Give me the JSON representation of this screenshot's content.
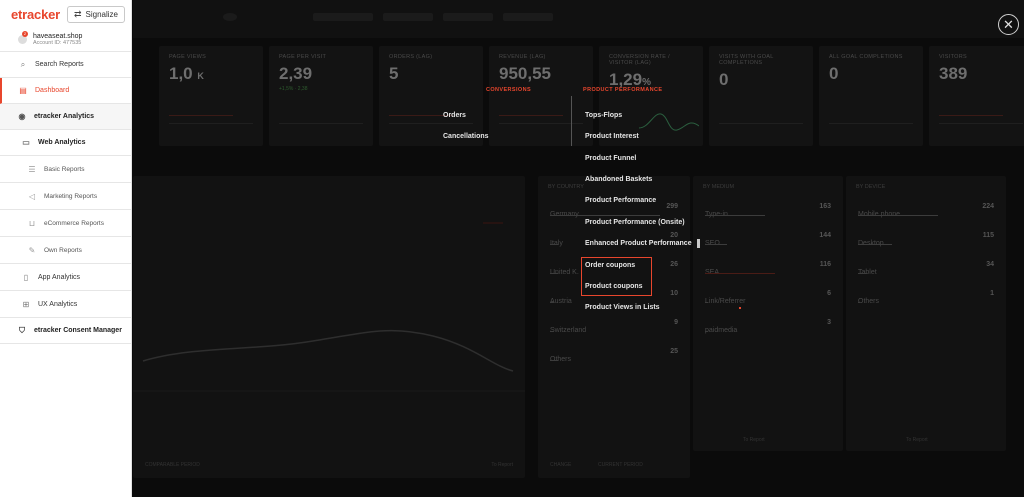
{
  "brand": {
    "logo": "etracker",
    "signalize_label": "Signalize"
  },
  "account": {
    "name": "haveaseat.shop",
    "id": "Account ID: 477535",
    "badge": "2"
  },
  "nav": {
    "search": "Search Reports",
    "dashboard": "Dashboard",
    "etracker_analytics": "etracker Analytics",
    "web_analytics": "Web Analytics",
    "basic_reports": "Basic Reports",
    "marketing_reports": "Marketing Reports",
    "ecommerce_reports": "eCommerce Reports",
    "own_reports": "Own Reports",
    "app_analytics": "App Analytics",
    "ux_analytics": "UX Analytics",
    "consent_manager": "etracker Consent Manager"
  },
  "menu": {
    "conversions_heading": "CONVERSIONS",
    "product_heading": "PRODUCT PERFORMANCE",
    "conversions": [
      "Orders",
      "Cancellations"
    ],
    "product": [
      "Tops-Flops",
      "Product Interest",
      "Product Funnel",
      "Abandoned Baskets",
      "Product Performance",
      "Product Performance (Onsite)",
      "Enhanced Product Performance",
      "Order coupons",
      "Product coupons",
      "Product Views in Lists"
    ]
  },
  "kpis": [
    {
      "label": "PAGE VIEWS",
      "value": "1,0",
      "unit": "K"
    },
    {
      "label": "PAGE PER VISIT",
      "value": "2,39",
      "sub": "+1,5% · 2,38"
    },
    {
      "label": "ORDERS (LAG)",
      "value": "5"
    },
    {
      "label": "REVENUE (LAG)",
      "value": "950,55"
    },
    {
      "label": "CONVERSION RATE / VISITOR (LAG)",
      "value": "1,29",
      "unit": "%"
    },
    {
      "label": "VISITS WITH GOAL COMPLETIONS",
      "value": "0"
    },
    {
      "label": "ALL GOAL COMPLETIONS",
      "value": "0"
    },
    {
      "label": "VISITORS",
      "value": "389"
    }
  ],
  "countries": {
    "title": "BY COUNTRY",
    "rows": [
      {
        "label": "Germany",
        "value": "299"
      },
      {
        "label": "Italy",
        "value": "20"
      },
      {
        "label": "United K.",
        "value": "26"
      },
      {
        "label": "Austria",
        "value": "10"
      },
      {
        "label": "Switzerland",
        "value": "9"
      },
      {
        "label": "Others",
        "value": "25"
      }
    ]
  },
  "mediums": {
    "title": "BY MEDIUM",
    "rows": [
      {
        "label": "Type-in",
        "value": "163"
      },
      {
        "label": "SEO",
        "value": "144"
      },
      {
        "label": "SEA",
        "value": "116"
      },
      {
        "label": "Link/Referrer",
        "value": "6"
      },
      {
        "label": "paidmedia",
        "value": "3"
      }
    ]
  },
  "devices": {
    "title": "BY DEVICE",
    "rows": [
      {
        "label": "Mobile phone",
        "value": "224"
      },
      {
        "label": "Desktop",
        "value": "115"
      },
      {
        "label": "Tablet",
        "value": "34"
      },
      {
        "label": "Others",
        "value": "1"
      }
    ]
  },
  "footer": {
    "comparable_period": "COMPARABLE PERIOD",
    "change": "CHANGE",
    "current_period": "CURRENT PERIOD",
    "to_report": "To Report"
  }
}
